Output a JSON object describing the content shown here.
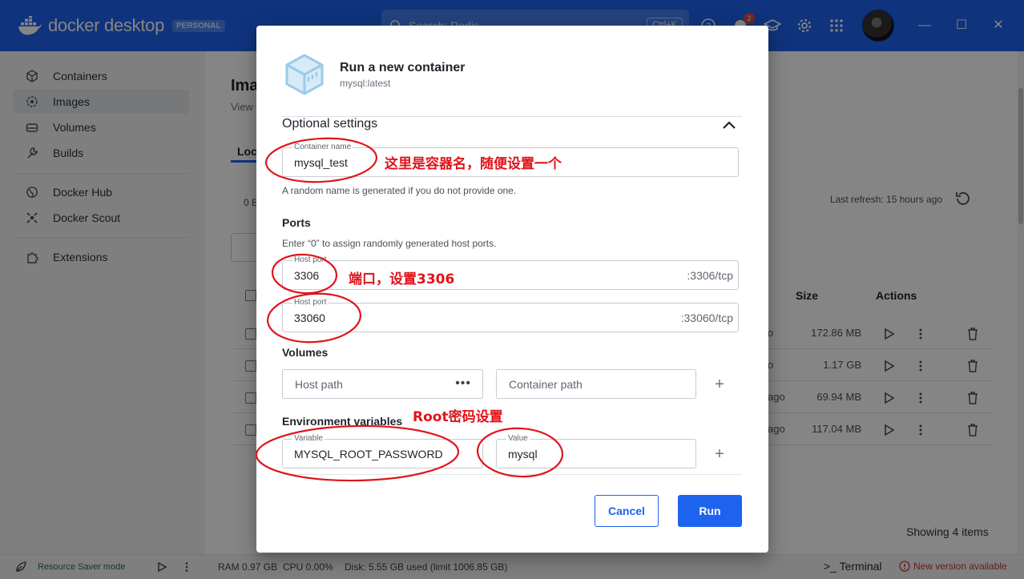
{
  "app": {
    "brand_name": "docker desktop",
    "plan_badge": "PERSONAL",
    "search_placeholder": "Search: Redis",
    "search_shortcut": "Ctrl+K",
    "notification_count": "2",
    "accent_color": "#1d63ed"
  },
  "sidebar": {
    "items": [
      {
        "label": "Containers",
        "icon": "cube-outline-icon"
      },
      {
        "label": "Images",
        "icon": "image-stack-icon",
        "active": true
      },
      {
        "label": "Volumes",
        "icon": "disk-icon"
      },
      {
        "label": "Builds",
        "icon": "wrench-icon"
      },
      {
        "label": "Docker Hub",
        "icon": "globe-icon"
      },
      {
        "label": "Docker Scout",
        "icon": "scout-icon"
      },
      {
        "label": "Extensions",
        "icon": "puzzle-icon"
      }
    ]
  },
  "background": {
    "title": "Ima",
    "subtitle": "View",
    "tab": "Loc",
    "usage": "0 E",
    "last_refresh": "Last refresh: 15 hours ago",
    "columns": {
      "size": "Size",
      "actions": "Actions"
    },
    "rows": [
      {
        "created": "o",
        "size": "172.86 MB"
      },
      {
        "created": "o",
        "size": "1.17 GB"
      },
      {
        "created": "ago",
        "size": "69.94 MB"
      },
      {
        "created": "ago",
        "size": "117.04 MB"
      }
    ],
    "showing": "Showing 4 items"
  },
  "footer": {
    "resource_saver": "Resource Saver mode",
    "ram": "RAM 0.97 GB",
    "cpu": "CPU 0.00%",
    "disk": "Disk: 5.55 GB used (limit 1006.85 GB)",
    "terminal": "Terminal",
    "new_version": "New version available"
  },
  "dialog": {
    "title": "Run a new container",
    "image": "mysql:latest",
    "optional_settings": "Optional settings",
    "container_name": {
      "label": "Container name",
      "value": "mysql_test",
      "helper": "A random name is generated if you do not provide one."
    },
    "ports": {
      "heading": "Ports",
      "helper": "Enter “0” to assign randomly generated host ports.",
      "rows": [
        {
          "label": "Host port",
          "value": "3306",
          "suffix": ":3306/tcp"
        },
        {
          "label": "Host port",
          "value": "33060",
          "suffix": ":33060/tcp"
        }
      ]
    },
    "volumes": {
      "heading": "Volumes",
      "host_placeholder": "Host path",
      "container_placeholder": "Container path"
    },
    "env": {
      "heading": "Environment variables",
      "variable_label": "Variable",
      "variable_value": "MYSQL_ROOT_PASSWORD",
      "value_label": "Value",
      "value_value": "mysql"
    },
    "cancel": "Cancel",
    "run": "Run"
  },
  "annotations": {
    "container_name_note": "这里是容器名，随便设置一个",
    "port_note": "端口，设置3306",
    "root_note": "Root密码设置",
    "color": "#e0141b"
  }
}
